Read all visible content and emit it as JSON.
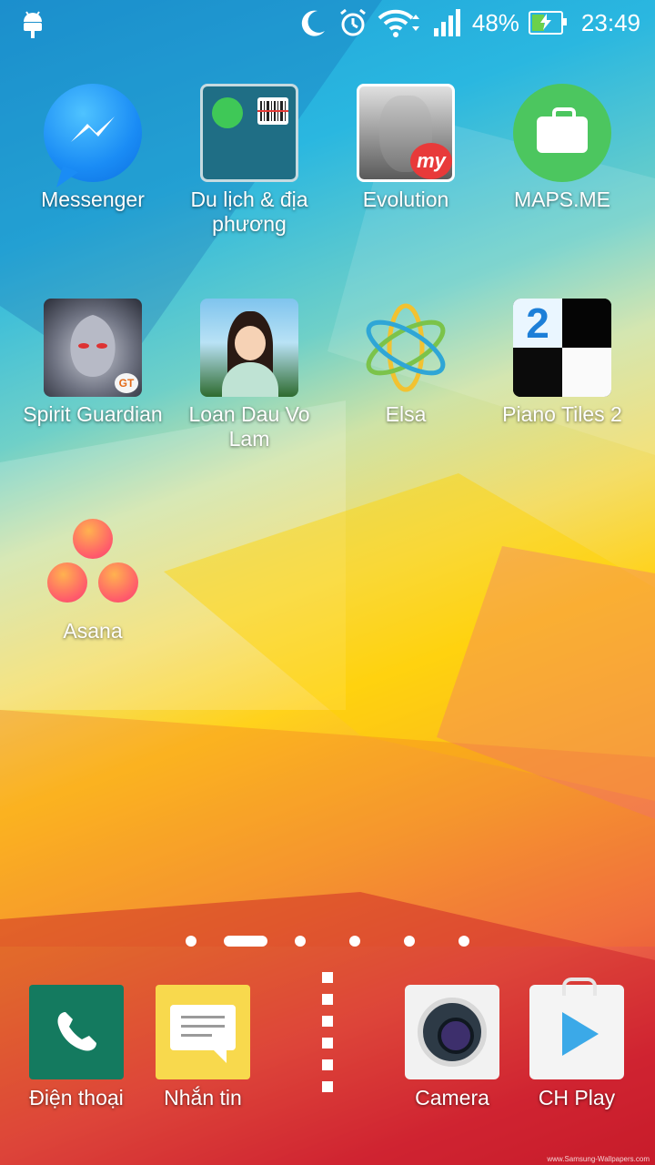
{
  "status_bar": {
    "battery_percent": "48%",
    "battery_level": 0.48,
    "time": "23:49",
    "icons": [
      "android-icon",
      "moon-icon",
      "alarm-icon",
      "wifi-icon",
      "signal-icon",
      "battery-charging-icon"
    ]
  },
  "home": {
    "apps": [
      {
        "label": "Messenger",
        "icon": "messenger-icon"
      },
      {
        "label": "Du lịch & địa phương",
        "icon": "folder-icon"
      },
      {
        "label": "Evolution",
        "icon": "evolution-icon",
        "badge": "my"
      },
      {
        "label": "MAPS.ME",
        "icon": "maps-me-icon"
      },
      {
        "label": "Spirit Guardian",
        "icon": "spirit-guardian-icon",
        "tag": "GT"
      },
      {
        "label": "Loan Dau Vo Lam",
        "icon": "loan-dau-vo-lam-icon"
      },
      {
        "label": "Elsa",
        "icon": "elsa-icon"
      },
      {
        "label": "Piano Tiles 2",
        "icon": "piano-tiles-icon",
        "number": "2"
      },
      {
        "label": "Asana",
        "icon": "asana-icon"
      }
    ]
  },
  "pager": {
    "pages": 6,
    "active_index": 1
  },
  "dock": {
    "items": [
      {
        "label": "Điện thoại",
        "icon": "phone-icon"
      },
      {
        "label": "Nhắn tin",
        "icon": "messages-icon"
      },
      {
        "label": "",
        "icon": "app-drawer-icon"
      },
      {
        "label": "Camera",
        "icon": "camera-icon"
      },
      {
        "label": "CH Play",
        "icon": "play-store-icon"
      }
    ]
  },
  "wallpaper_credit": "www.Samsung-Wallpapers.com",
  "colors": {
    "messenger": "#1a8cf5",
    "maps": "#4cc65f",
    "phone": "#147a5f",
    "messages": "#f8d94d"
  }
}
